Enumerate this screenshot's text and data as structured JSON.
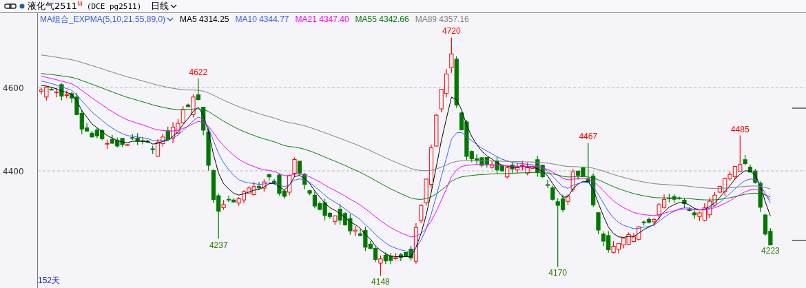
{
  "header": {
    "symbol": "液化气2511",
    "market_badge": "M",
    "code": "(DCE pg2511)",
    "period": "日线"
  },
  "legend": [
    {
      "label": "MA组合_EXPMA(5,10,21,55,89,0)",
      "color": "#3a5fd8",
      "kind": "selector"
    },
    {
      "label": "MA5 4314.25",
      "color": "#000000",
      "kind": "line"
    },
    {
      "label": "MA10 4344.77",
      "color": "#3a5fff",
      "kind": "line"
    },
    {
      "label": "MA21 4347.40",
      "color": "#ff00ff",
      "kind": "line"
    },
    {
      "label": "MA55 4342.66",
      "color": "#008000",
      "kind": "line"
    },
    {
      "label": "MA89 4357.16",
      "color": "#808080",
      "kind": "line"
    }
  ],
  "y_axis": {
    "labels": [
      "4600",
      "4400"
    ]
  },
  "price_marks": [
    {
      "text": "4622",
      "kind": "high"
    },
    {
      "text": "4237",
      "kind": "low"
    },
    {
      "text": "4148",
      "kind": "low"
    },
    {
      "text": "4720",
      "kind": "high"
    },
    {
      "text": "4170",
      "kind": "low"
    },
    {
      "text": "4467",
      "kind": "high"
    },
    {
      "text": "4485",
      "kind": "high"
    },
    {
      "text": "4223",
      "kind": "low"
    }
  ],
  "day_count": "152天"
}
